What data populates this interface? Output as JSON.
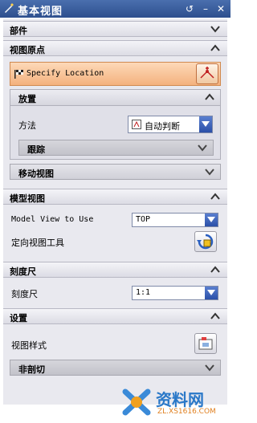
{
  "window": {
    "title": "基本视图",
    "buttons": [
      "reset-icon",
      "minimize-icon",
      "close-icon"
    ]
  },
  "sections": {
    "parts": {
      "label": "部件"
    },
    "view_origin": {
      "label": "视图原点",
      "specify_label": "Specify Location",
      "placement": {
        "label": "放置",
        "method_label": "方法",
        "method_value": "自动判断",
        "track_label": "跟踪"
      },
      "move_view": {
        "label": "移动视图"
      }
    },
    "model_view": {
      "label": "模型视图",
      "model_view_label": "Model View to Use",
      "model_view_value": "TOP",
      "orient_tool_label": "定向视图工具"
    },
    "scale": {
      "label": "刻度尺",
      "scale_label": "刻度尺",
      "scale_value": "1:1"
    },
    "settings": {
      "label": "设置",
      "view_style_label": "视图样式",
      "non_section": "非剖切"
    }
  },
  "watermark": {
    "text": "资料网",
    "url": "ZL.XS1616.COM"
  },
  "colors": {
    "titlebar": "#2d4f8e",
    "specify_bg": "#f4b27e",
    "dropdown_arrow": "#2a4fa8"
  }
}
